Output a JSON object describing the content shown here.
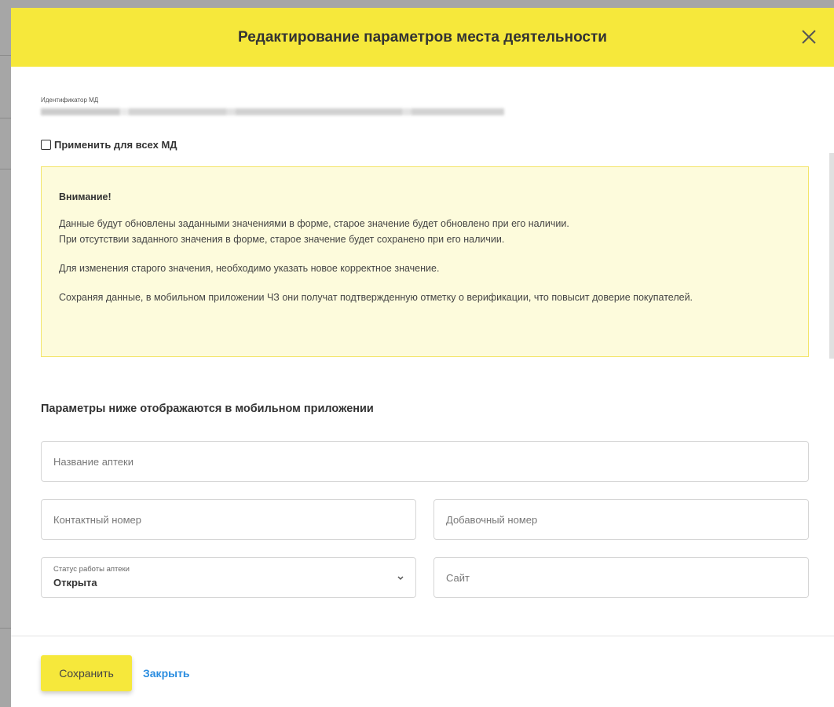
{
  "modal": {
    "title": "Редактирование параметров места деятельности",
    "id_label": "Идентификатор МД",
    "apply_all_label": "Применить для всех МД"
  },
  "alert": {
    "title": "Внимание!",
    "line1": "Данные будут обновлены заданными значениями в форме, старое значение будет обновлено при его наличии.",
    "line2": "При отсутствии заданного значения в форме, старое значение будет сохранено при его наличии.",
    "line3": "Для изменения старого значения, необходимо указать новое корректное значение.",
    "line4": "Сохраняя данные, в мобильном приложении ЧЗ они получат подтвержденную отметку о верификации, что повысит доверие покупателей."
  },
  "form": {
    "section_title": "Параметры ниже отображаются в мобильном приложении",
    "pharmacy_name_placeholder": "Название аптеки",
    "contact_phone_placeholder": "Контактный номер",
    "extension_placeholder": "Добавочный номер",
    "status_label": "Статус работы аптеки",
    "status_value": "Открыта",
    "site_placeholder": "Сайт"
  },
  "footer": {
    "save_label": "Сохранить",
    "close_label": "Закрыть"
  },
  "colors": {
    "accent": "#f6e83b",
    "link": "#2b8de0",
    "alert_bg": "#fdfbdc",
    "alert_border": "#f3e56a"
  }
}
